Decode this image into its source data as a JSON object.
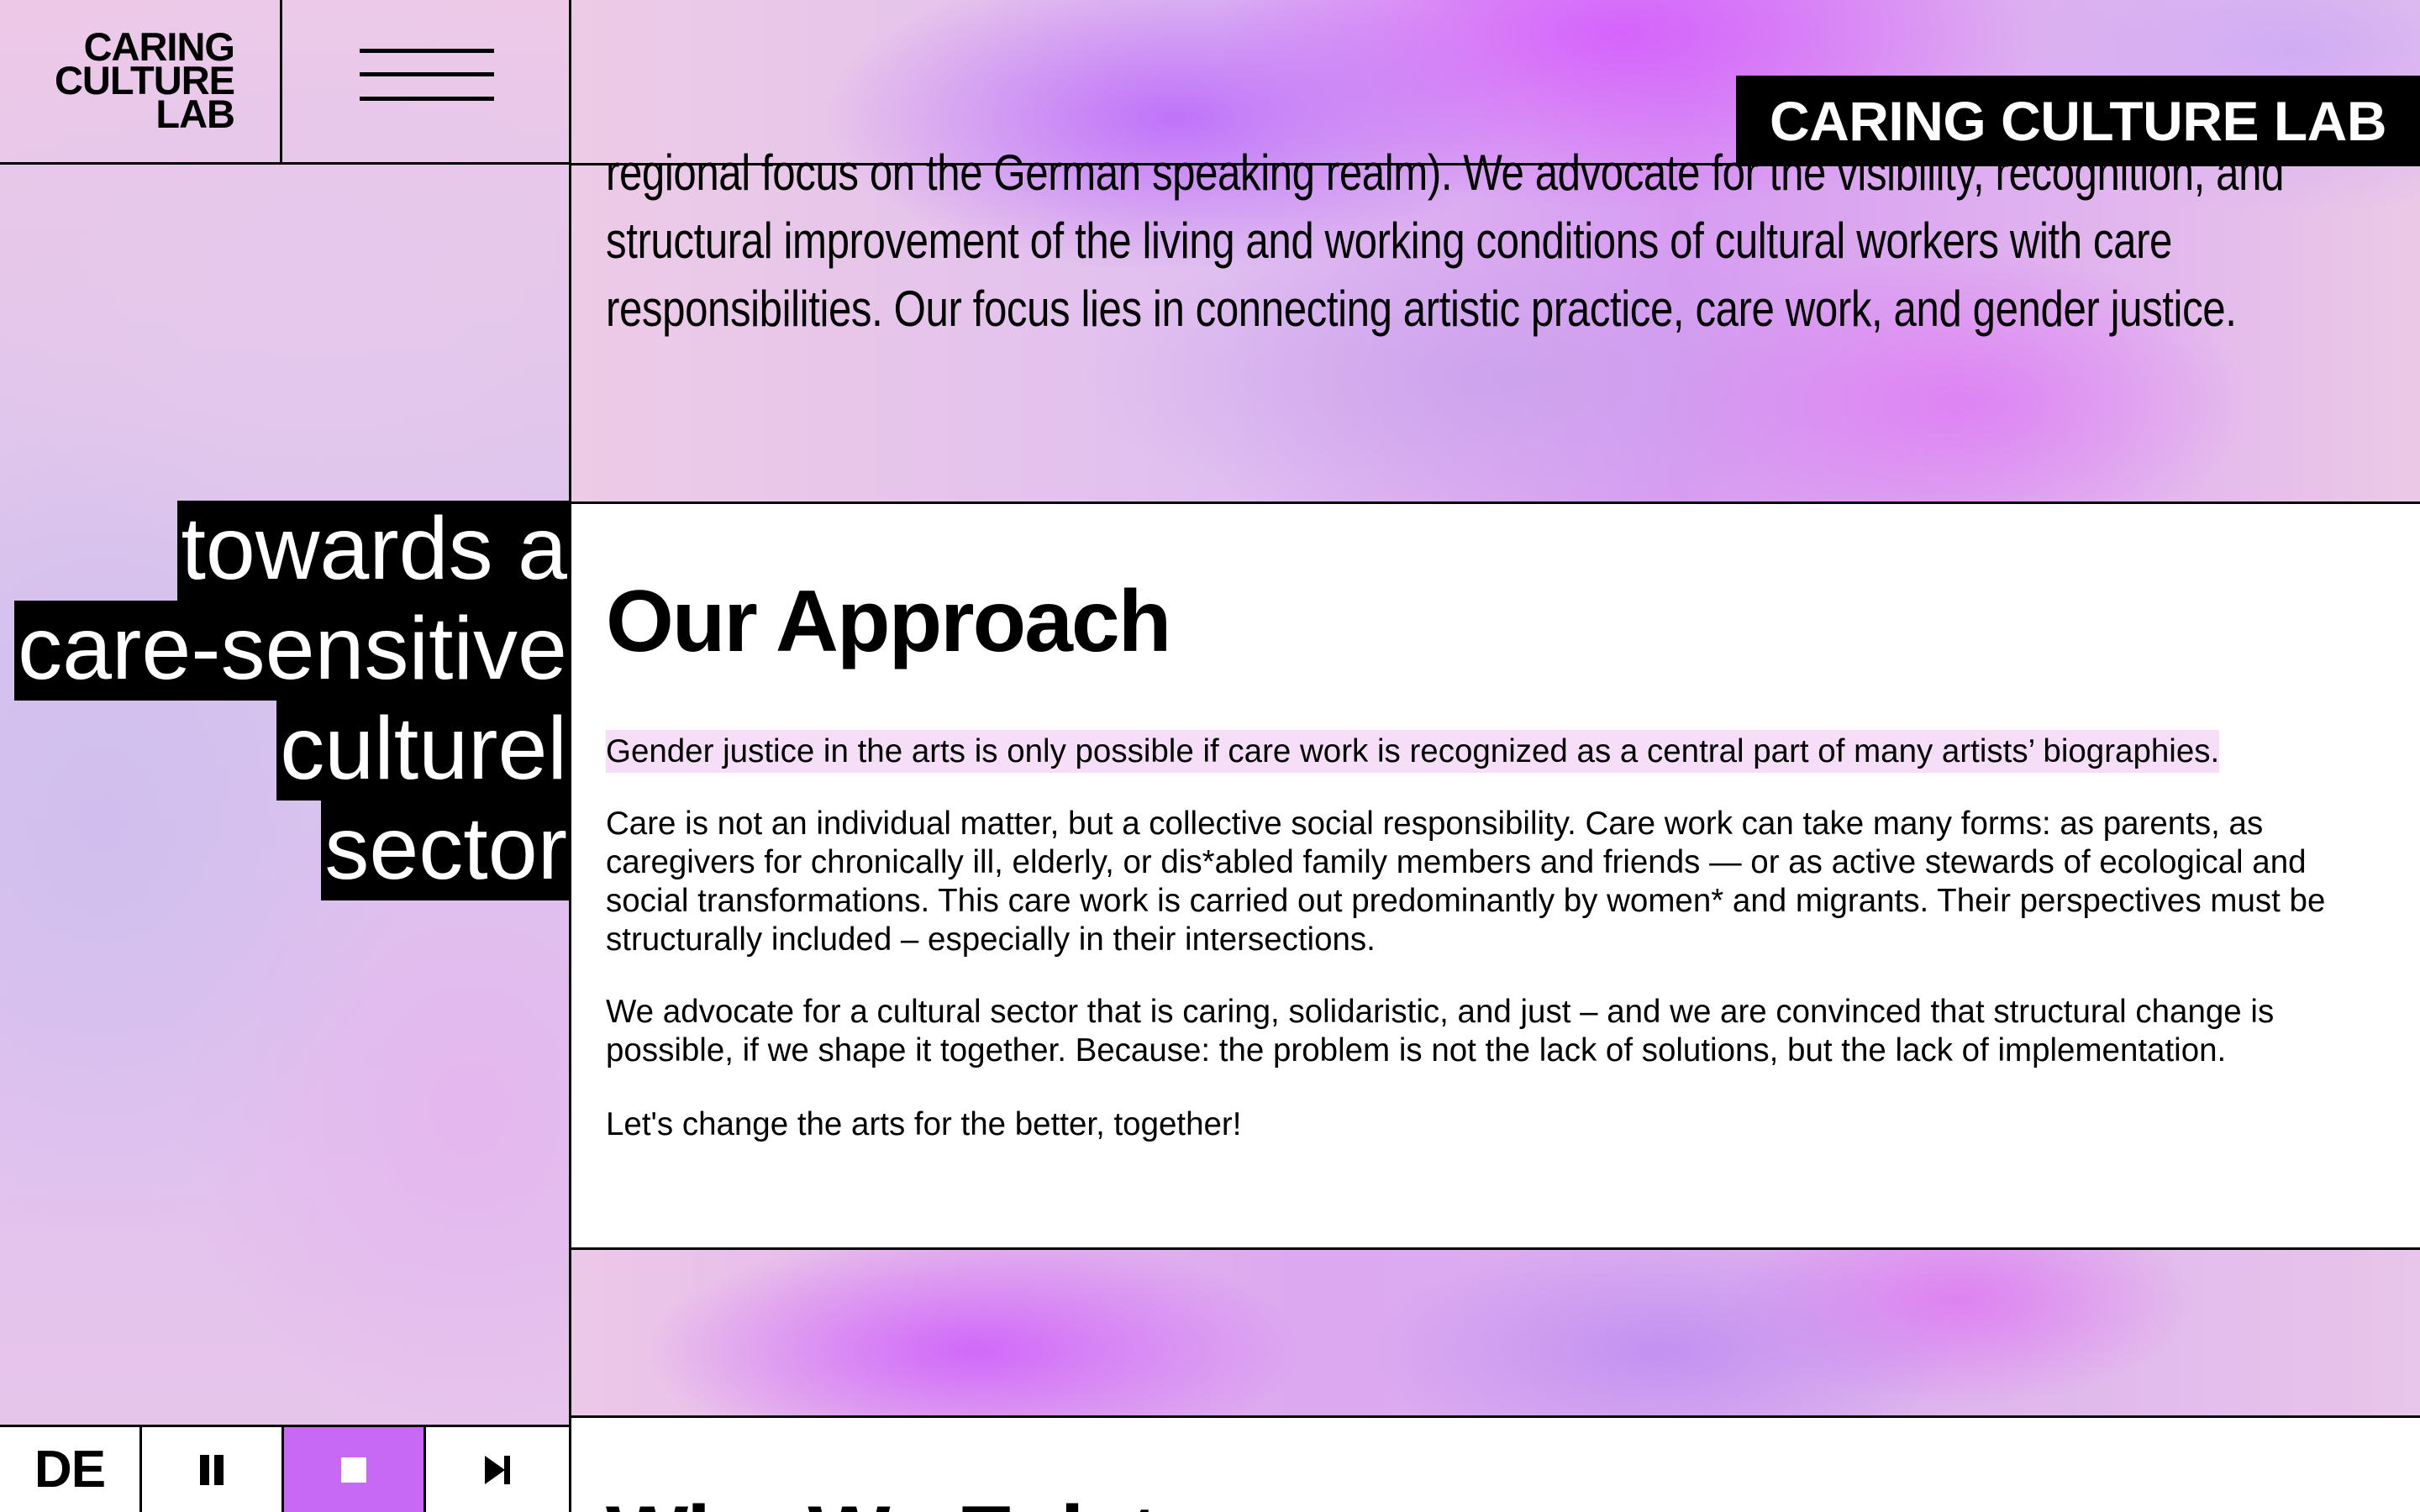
{
  "logo": {
    "lines": [
      "CARING",
      "CULTURE",
      "LAB"
    ]
  },
  "menu": {
    "icon": "hamburger-menu-icon"
  },
  "brand": {
    "label": "CARING CULTURE LAB"
  },
  "tagline": {
    "lines": [
      "towards a",
      "care-sensitive",
      "culturel",
      "sector"
    ]
  },
  "intro": {
    "text": "regional focus on the German speaking realm). We advocate for the visibility, recognition, and structural improvement of the living and working conditions of cultural workers with care responsibilities. Our focus lies in connecting artistic practice, care work, and gender justice."
  },
  "approach": {
    "title": "Our Approach",
    "highlight": "Gender justice in the arts is only possible if care work is recognized as a central part of many artists’ biographies.",
    "paragraph1": "Care is not an individual matter, but a collective social responsibility. Care work can take many forms: as parents, as caregivers for chronically ill, elderly, or dis*abled family members and friends — or as active stewards of ecological and social transformations. This care work is carried out predominantly by women* and migrants. Their perspectives must be structurally included – especially in their intersections.",
    "paragraph2": "We advocate for a cultural sector that is caring, solidaristic, and just – and we are convinced that structural change is possible, if we shape it together. Because: the problem is not the lack of solutions, but the lack of implementation.",
    "paragraph3": "Let's change the arts for the better, together!"
  },
  "next_section": {
    "title": "Why We Exist"
  },
  "player": {
    "language_label": "DE",
    "icons": [
      "pause-icon",
      "stop-icon",
      "skip-next-icon"
    ],
    "accent_color": "#c769f4"
  }
}
